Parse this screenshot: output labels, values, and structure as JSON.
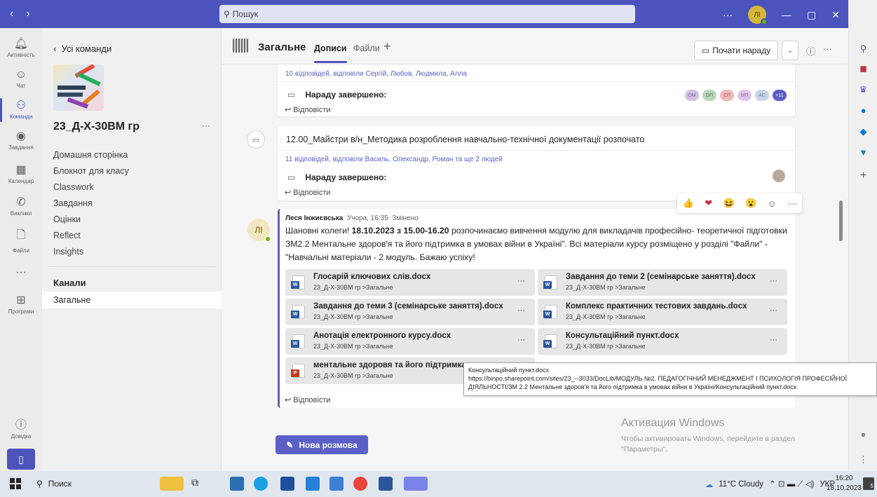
{
  "titlebar": {
    "search_placeholder": "Пошук",
    "more": "···",
    "avatar_initials": "ЛІ",
    "minimize": "—",
    "restore": "▢",
    "close": "✕"
  },
  "rail": {
    "items": [
      {
        "label": "Активність",
        "icon": "bell-icon"
      },
      {
        "label": "Чат",
        "icon": "chat-icon"
      },
      {
        "label": "Команди",
        "icon": "teams-icon"
      },
      {
        "label": "Завдання",
        "icon": "assignments-icon"
      },
      {
        "label": "Календар",
        "icon": "calendar-icon"
      },
      {
        "label": "Виклики",
        "icon": "phone-icon"
      },
      {
        "label": "Файли",
        "icon": "file-icon"
      },
      {
        "label": "···",
        "icon": "more-icon"
      },
      {
        "label": "Програми",
        "icon": "apps-icon"
      },
      {
        "label": "Довідка",
        "icon": "help-icon"
      }
    ]
  },
  "sidebar": {
    "back": "Усі команди",
    "team_name": "23_Д-Х-30ВМ гр",
    "more": "···",
    "links": [
      "Домашня сторінка",
      "Блокнот для класу",
      "Classwork",
      "Завдання",
      "Оцінки",
      "Reflect",
      "Insights"
    ],
    "channels_header": "Канали",
    "channels": [
      "Загальне"
    ]
  },
  "channel": {
    "title": "Загальне",
    "tabs": [
      "Дописи",
      "Файли"
    ],
    "add_tab": "+",
    "meet_button": "Почати нараду",
    "info": "ⓘ",
    "more": "···"
  },
  "feed": {
    "meeting1": {
      "replies": "10 відповідей, відповіли Сергій, Любов, Людмила, Алла",
      "ended": "Нараду завершено:",
      "reply": "Відповісти",
      "participants": [
        {
          "initials": "ОМ",
          "color": "#b9a3d8"
        },
        {
          "initials": "ОП",
          "color": "#8fb98f"
        },
        {
          "initials": "СП",
          "color": "#e88a8a"
        },
        {
          "initials": "МП",
          "color": "#c9a3d8"
        },
        {
          "initials": "АС",
          "color": "#9ab3c9"
        },
        {
          "initials": "+11",
          "color": "#5b5fc7"
        }
      ]
    },
    "meeting2": {
      "title": "12.00_Майстри в/н_Методика розроблення навчально-технічної документації розпочато",
      "replies": "11 відповідей, відповіли Василь, Олександр, Роман та ще 2 людей",
      "ended": "Нараду завершено:",
      "reply": "Відповісти"
    },
    "reactions": [
      "👍",
      "❤",
      "😆",
      "😮",
      "☺",
      "···"
    ],
    "post": {
      "avatar": "ЛІ",
      "author": "Леся Інжиєвська",
      "time": "Учора, 16:35",
      "edited": "Змінено",
      "body_1": "Шановні колеги! ",
      "body_date": "18.10.2023",
      "body_2": " з ",
      "body_time": "15.00-16.20",
      "body_3": " розпочинаємо вивчення модулю  для викладачів професійно- теоретичної підготовки ЗМ2.2 Ментальне здоров'я та його підтримка в умовах війни в Україні\". Всі матеріали курсу розміщено у розділі \"Файли\" - \"Навчальні матеріали  - 2 модуль. Бажаю успіху!",
      "files": [
        {
          "name": "Глосарій ключових слів.docx",
          "path": "23_Д-Х-30ВМ гр >Загальне",
          "type": "word"
        },
        {
          "name": "Завдання до теми 2 (семінарське заняття).docx",
          "path": "23_Д-Х-30ВМ гр >Загальне",
          "type": "word"
        },
        {
          "name": "Завдання до теми 3 (семінарське заняття).docx",
          "path": "23_Д-Х-30ВМ гр >Загальне",
          "type": "word"
        },
        {
          "name": "Комплекс практичних тестових завдань.docx",
          "path": "23_Д-Х-30ВМ гр >Загальне",
          "type": "word"
        },
        {
          "name": "Анотація електронного курсу.docx",
          "path": "23_Д-Х-30ВМ гр >Загальне",
          "type": "word"
        },
        {
          "name": "Консультаційний пункт.docx",
          "path": "23_Д-Х-30ВМ гр >Загальне",
          "type": "word"
        },
        {
          "name": "ментальне здоровя та його підтримка в",
          "path": "23_Д-Х-30ВМ гр >Загальне",
          "type": "ppt"
        }
      ],
      "file_more": "···",
      "reply": "Відповісти"
    },
    "tooltip": {
      "title": "Консультаційний пункт.docx",
      "url": "https://binpo.sharepoint.com/sites/23_--3033/DocLib/МОДУЛЬ №2. ПЕДАГОГІЧНИЙ МЕНЕДЖМЕНТ І ПСИХОЛОГІЯ ПРОФЕСІЙНОЇ ДІЯЛЬНОСТІ/ЗМ 2.2 Ментальне здоров'я та його підтримка в умовах війни в Україні/Консультаційний пункт.docx"
    },
    "new_conversation": "Нова розмова"
  },
  "watermark": {
    "title": "Активация Windows",
    "text": "Чтобы активировать Windows, перейдите в раздел \"Параметры\"."
  },
  "taskbar": {
    "search": "Поиск",
    "weather": "11°C  Cloudy",
    "lang": "УКР",
    "time": "16:20",
    "date": "18.10.2023",
    "notifications": "5"
  }
}
